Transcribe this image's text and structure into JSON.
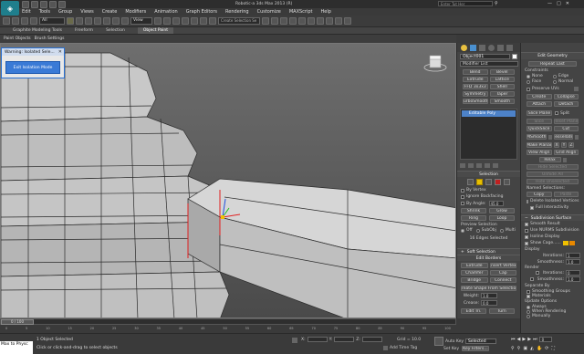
{
  "app": {
    "title": "Robotic-a 3ds Max 2013 (R)",
    "search_placeholder": "Enter Tut Her",
    "logo": "3ds-max-logo"
  },
  "menubar": [
    "Edit",
    "Tools",
    "Group",
    "Views",
    "Create",
    "Modifiers",
    "Animation",
    "Graph Editors",
    "Rendering",
    "Customize",
    "MAXScript",
    "Help"
  ],
  "toolbar": {
    "selection_filter": "All",
    "view_dropdown": "View",
    "create_selection_set": "Create Selection Se"
  },
  "ribbon": {
    "tabs": [
      "Graphite Modeling Tools",
      "Freeform",
      "Selection",
      "Object Paint"
    ],
    "active_tab": "Object Paint",
    "subtabs": [
      "Paint Objects",
      "Brush Settings"
    ]
  },
  "warning_dialog": {
    "title": "Warning: Isolated Sele...",
    "button": "Exit Isolation Mode"
  },
  "cmd_panel": {
    "object_name": "Object001",
    "modifier_list": "Modifier List",
    "modifier_buttons": [
      [
        "Bend",
        "Bevel"
      ],
      [
        "Extrude",
        "Lattice"
      ],
      [
        "FFD 3x3x3",
        "Shell"
      ],
      [
        "Symmetry",
        "Taper"
      ],
      [
        "TurboSmooth",
        "Smooth"
      ]
    ],
    "stack_item": "Editable Poly",
    "selection_title": "Selection",
    "by_vertex": "By Vertex",
    "ignore_backfacing": "Ignore Backfacing",
    "by_angle": "By Angle:",
    "by_angle_value": "45.0",
    "shrink": "Shrink",
    "grow": "Grow",
    "ring": "Ring",
    "loop": "Loop",
    "preview_selection": "Preview Selection",
    "off": "Off",
    "subobj": "SubObj",
    "multi": "Multi",
    "selected_count": "16 Edges Selected",
    "soft_selection": "Soft Selection",
    "edit_borders": "Edit Borders",
    "extrude": "Extrude",
    "insert_vertex": "Insert Vertex",
    "chamfer": "Chamfer",
    "cap": "Cap",
    "bridge": "Bridge",
    "connect": "Connect",
    "create_shape": "Create Shape From Selection",
    "weight_label": "Weight:",
    "weight_value": "1.0",
    "crease_label": "Crease:",
    "crease_value": "0.0",
    "edit_tri": "Edit Tri.",
    "turn": "Turn"
  },
  "edit_geometry": {
    "title": "Edit Geometry",
    "repeat_last": "Repeat Last",
    "constraints": "Constraints",
    "none": "None",
    "edge": "Edge",
    "face": "Face",
    "normal": "Normal",
    "preserve_uvs": "Preserve UVs",
    "create": "Create",
    "collapse": "Collapse",
    "attach": "Attach",
    "detach": "Detach",
    "slice_plane": "Slice Plane",
    "split": "Split",
    "slice": "Slice",
    "reset_plane": "Reset Plane",
    "quickslice": "QuickSlice",
    "cut": "Cut",
    "msmooth": "MSmooth",
    "tessellate": "Tessellate",
    "make_planar": "Make Planar",
    "x": "X",
    "y": "Y",
    "z": "Z",
    "view_align": "View Align",
    "grid_align": "Grid Align",
    "relax": "Relax",
    "hide_selected": "Hide Selected",
    "unhide_all": "Unhide All",
    "hide_unselected": "Hide Unselected",
    "named_selections": "Named Selections:",
    "copy": "Copy",
    "paste": "Paste",
    "delete_isolated": "Delete Isolated Vertices",
    "full_interactivity": "Full Interactivity",
    "subdiv_title": "Subdivision Surface",
    "smooth_result": "Smooth Result",
    "use_nurms": "Use NURMS Subdivision",
    "isoline_display": "Isoline Display",
    "show_cage": "Show Cage......",
    "display": "Display",
    "iterations_label": "Iterations:",
    "iterations_value": "1",
    "smoothness_label": "Smoothness:",
    "smoothness_value": "1.0",
    "render": "Render",
    "r_iterations_value": "0",
    "r_smoothness_value": "1.0",
    "separate_by": "Separate By",
    "smoothing_groups": "Smoothing Groups",
    "materials": "Materials",
    "update_options": "Update Options",
    "always": "Always",
    "when_rendering": "When Rendering",
    "manually": "Manually",
    "cage_color_1": "#f0c000",
    "cage_color_2": "#e88800"
  },
  "timeline": {
    "frame_display": "0 / 100",
    "ticks": [
      "0",
      "5",
      "10",
      "15",
      "20",
      "25",
      "30",
      "35",
      "40",
      "45",
      "50",
      "55",
      "60",
      "65",
      "70",
      "75",
      "80",
      "85",
      "90",
      "95",
      "100"
    ]
  },
  "status": {
    "maxscript": "Max to Physc",
    "objects_selected": "1 Object Selected",
    "prompt": "Click or click-and-drag to select objects",
    "x_label": "X:",
    "y_label": "Y:",
    "z_label": "Z:",
    "grid": "Grid = 10.0",
    "add_time_tag": "Add Time Tag",
    "auto_key": "Auto Key",
    "set_key": "Set Key",
    "selected": "Selected",
    "key_filters": "Key Filters...",
    "frame": "0"
  },
  "accent": "#f0c000",
  "highlight_blue": "#2e6fd8"
}
